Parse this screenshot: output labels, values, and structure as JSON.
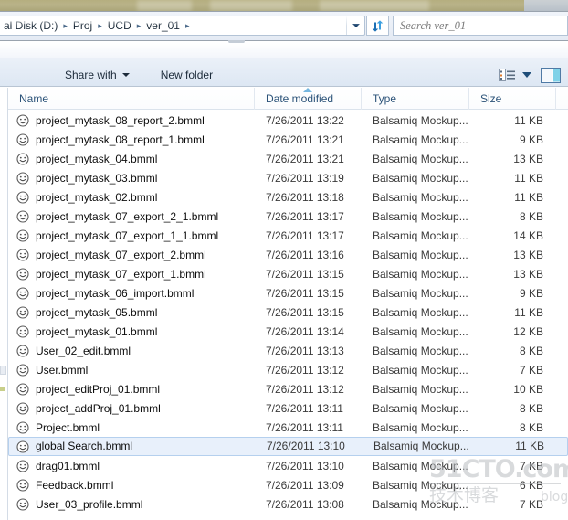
{
  "window": {
    "breadcrumb": {
      "name": "address-breadcrumb",
      "segments": [
        "al Disk (D:)",
        "Proj",
        "UCD",
        "ver_01"
      ],
      "separator": "▸"
    },
    "refresh_title": "Refresh",
    "search": {
      "placeholder": "Search ver_01",
      "value": ""
    }
  },
  "toolbar": {
    "share_with_label": "Share with",
    "new_folder_label": "New folder",
    "change_view_title": "Change your view",
    "preview_pane_title": "Show the preview pane"
  },
  "columns": [
    {
      "key": "name",
      "label": "Name",
      "sorted": false
    },
    {
      "key": "date",
      "label": "Date modified",
      "sorted": true
    },
    {
      "key": "type",
      "label": "Type",
      "sorted": false
    },
    {
      "key": "size",
      "label": "Size",
      "sorted": false
    }
  ],
  "files": [
    {
      "name": "project_mytask_08_report_2.bmml",
      "date": "7/26/2011 13:22",
      "type": "Balsamiq Mockup...",
      "size": "11 KB",
      "selected": false
    },
    {
      "name": "project_mytask_08_report_1.bmml",
      "date": "7/26/2011 13:21",
      "type": "Balsamiq Mockup...",
      "size": "9 KB",
      "selected": false
    },
    {
      "name": "project_mytask_04.bmml",
      "date": "7/26/2011 13:21",
      "type": "Balsamiq Mockup...",
      "size": "13 KB",
      "selected": false
    },
    {
      "name": "project_mytask_03.bmml",
      "date": "7/26/2011 13:19",
      "type": "Balsamiq Mockup...",
      "size": "11 KB",
      "selected": false
    },
    {
      "name": "project_mytask_02.bmml",
      "date": "7/26/2011 13:18",
      "type": "Balsamiq Mockup...",
      "size": "11 KB",
      "selected": false
    },
    {
      "name": "project_mytask_07_export_2_1.bmml",
      "date": "7/26/2011 13:17",
      "type": "Balsamiq Mockup...",
      "size": "8 KB",
      "selected": false
    },
    {
      "name": "project_mytask_07_export_1_1.bmml",
      "date": "7/26/2011 13:17",
      "type": "Balsamiq Mockup...",
      "size": "14 KB",
      "selected": false
    },
    {
      "name": "project_mytask_07_export_2.bmml",
      "date": "7/26/2011 13:16",
      "type": "Balsamiq Mockup...",
      "size": "13 KB",
      "selected": false
    },
    {
      "name": "project_mytask_07_export_1.bmml",
      "date": "7/26/2011 13:15",
      "type": "Balsamiq Mockup...",
      "size": "13 KB",
      "selected": false
    },
    {
      "name": "project_mytask_06_import.bmml",
      "date": "7/26/2011 13:15",
      "type": "Balsamiq Mockup...",
      "size": "9 KB",
      "selected": false
    },
    {
      "name": "project_mytask_05.bmml",
      "date": "7/26/2011 13:15",
      "type": "Balsamiq Mockup...",
      "size": "11 KB",
      "selected": false
    },
    {
      "name": "project_mytask_01.bmml",
      "date": "7/26/2011 13:14",
      "type": "Balsamiq Mockup...",
      "size": "12 KB",
      "selected": false
    },
    {
      "name": "User_02_edit.bmml",
      "date": "7/26/2011 13:13",
      "type": "Balsamiq Mockup...",
      "size": "8 KB",
      "selected": false
    },
    {
      "name": "User.bmml",
      "date": "7/26/2011 13:12",
      "type": "Balsamiq Mockup...",
      "size": "7 KB",
      "selected": false
    },
    {
      "name": "project_editProj_01.bmml",
      "date": "7/26/2011 13:12",
      "type": "Balsamiq Mockup...",
      "size": "10 KB",
      "selected": false
    },
    {
      "name": "project_addProj_01.bmml",
      "date": "7/26/2011 13:11",
      "type": "Balsamiq Mockup...",
      "size": "8 KB",
      "selected": false
    },
    {
      "name": "Project.bmml",
      "date": "7/26/2011 13:11",
      "type": "Balsamiq Mockup...",
      "size": "8 KB",
      "selected": false
    },
    {
      "name": "global Search.bmml",
      "date": "7/26/2011 13:10",
      "type": "Balsamiq Mockup...",
      "size": "11 KB",
      "selected": true
    },
    {
      "name": "drag01.bmml",
      "date": "7/26/2011 13:10",
      "type": "Balsamiq Mockup...",
      "size": "7 KB",
      "selected": false
    },
    {
      "name": "Feedback.bmml",
      "date": "7/26/2011 13:09",
      "type": "Balsamiq Mockup...",
      "size": "6 KB",
      "selected": false
    },
    {
      "name": "User_03_profile.bmml",
      "date": "7/26/2011 13:08",
      "type": "Balsamiq Mockup...",
      "size": "7 KB",
      "selected": false
    }
  ],
  "watermark": {
    "main": "51CTO.com",
    "sub": "技术博客",
    "blog": "blog"
  },
  "colors": {
    "selection_bg": "#e8f0fb",
    "selection_border": "#b5d0ee",
    "header_text": "#2b5278",
    "sort_arrow": "#76b7e0",
    "desktop": "#b5ae7f"
  }
}
